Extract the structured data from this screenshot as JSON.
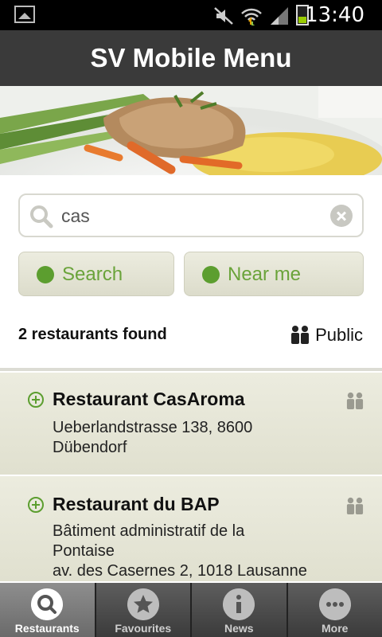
{
  "status_bar": {
    "time": "13:40"
  },
  "header": {
    "title": "SV Mobile Menu"
  },
  "search": {
    "query": "cas"
  },
  "buttons": {
    "search_label": "Search",
    "near_label": "Near me"
  },
  "results": {
    "count_label": "2 restaurants found",
    "audience_label": "Public",
    "items": [
      {
        "name": "Restaurant CasAroma",
        "address": "Ueberlandstrasse 138, 8600\nDübendorf"
      },
      {
        "name": "Restaurant du BAP",
        "address": "Bâtiment administratif de la\nPontaise\nav. des Casernes 2, 1018 Lausanne"
      }
    ]
  },
  "tabs": [
    {
      "label": "Restaurants",
      "icon": "search-icon",
      "active": true
    },
    {
      "label": "Favourites",
      "icon": "star-icon",
      "active": false
    },
    {
      "label": "News",
      "icon": "info-icon",
      "active": false
    },
    {
      "label": "More",
      "icon": "more-icon",
      "active": false
    }
  ],
  "colors": {
    "accent": "#6aa33a",
    "header_bg": "#3a3a3a",
    "list_bg": "#e6e6d6"
  }
}
